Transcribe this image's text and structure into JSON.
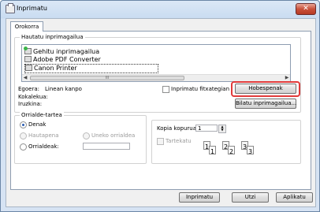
{
  "window": {
    "title": "Inprimatu",
    "close": "✕"
  },
  "tabs": [
    {
      "label": "Orokorra"
    }
  ],
  "select_printer": {
    "legend": "Hautatu inprimagailua",
    "printers": [
      {
        "label": "Gehitu inprimagailua",
        "icon": "add-printer-icon"
      },
      {
        "label": "Adobe PDF Converter",
        "icon": "printer-icon"
      },
      {
        "label": "Canon Printer",
        "icon": "printer-icon",
        "selected": true
      }
    ],
    "scroll_thumb": "III"
  },
  "status": {
    "egoera_label": "Egoera:",
    "egoera_value": "Linean kanpo",
    "kokalekua_label": "Kokalekua:",
    "iruzkina_label": "Iruzkina:",
    "print_to_file_label": "Inprimatu fitxategian",
    "preferences_button": "Hobespenak",
    "find_printer_button": "Bilatu inprimagailua..."
  },
  "page_range": {
    "legend": "Orrialde-tartea",
    "all": "Denak",
    "selection": "Hautapena",
    "current_page": "Uneko orrialdea",
    "pages": "Orrialdeak:"
  },
  "copies": {
    "label": "Kopia kopurua:",
    "value": "1",
    "collate_label": "Tartekatu",
    "collate_pages": [
      "1",
      "1",
      "2",
      "2",
      "3",
      "3"
    ]
  },
  "buttons": {
    "print": "Inprimatu",
    "cancel": "Utzi",
    "apply": "Aplikatu"
  },
  "colors": {
    "highlight": "#e13a3a",
    "radio_dot": "#2c5eb3"
  }
}
